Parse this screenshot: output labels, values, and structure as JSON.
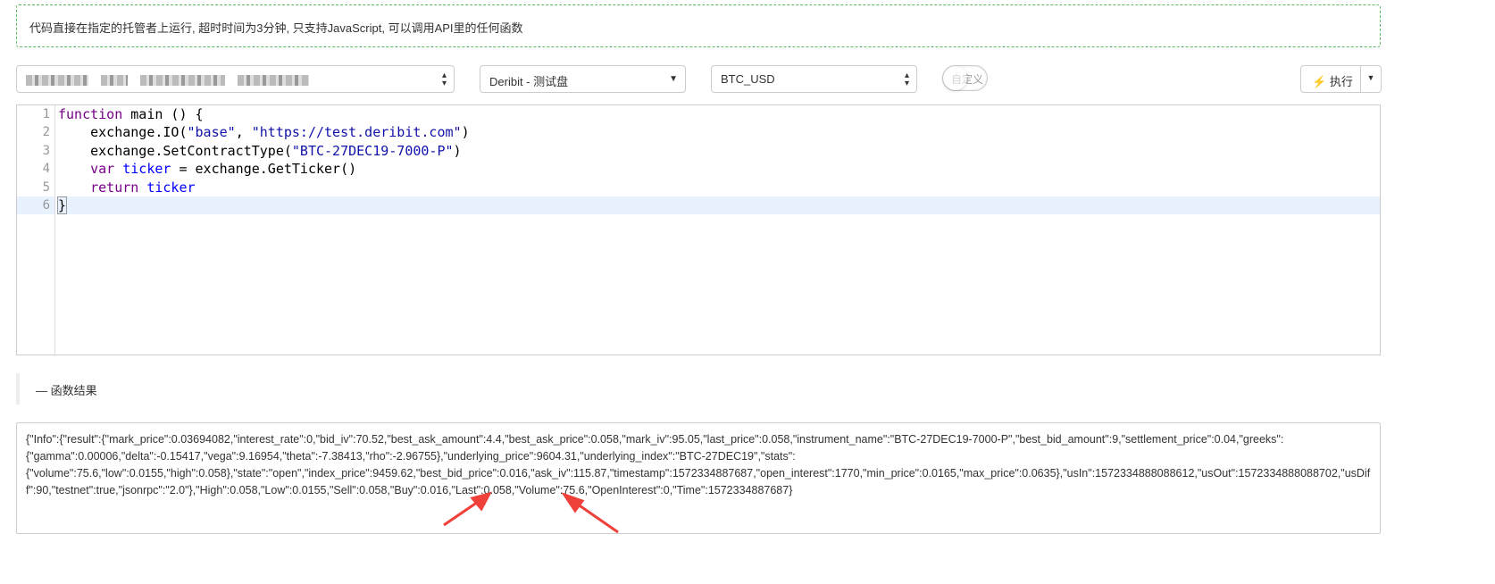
{
  "notice": "代码直接在指定的托管者上运行, 超时时间为3分钟, 只支持JavaScript, 可以调用API里的任何函数",
  "selects": {
    "exchange": "Deribit - 测试盘",
    "pair": "BTC_USD"
  },
  "toggle_label": "自定义",
  "run_label": "执行",
  "code_lines": [
    {
      "num": "1"
    },
    {
      "num": "2"
    },
    {
      "num": "3"
    },
    {
      "num": "4"
    },
    {
      "num": "5"
    },
    {
      "num": "6"
    }
  ],
  "code": {
    "l1a": "function",
    "l1b": " main () {",
    "l2a": "    exchange.IO(",
    "l2b": "\"base\"",
    "l2c": ", ",
    "l2d": "\"https://test.deribit.com\"",
    "l2e": ")",
    "l3a": "    exchange.SetContractType(",
    "l3b": "\"BTC-27DEC19-7000-P\"",
    "l3c": ")",
    "l4a": "    var",
    "l4b": " ticker",
    "l4c": " = exchange.GetTicker()",
    "l5a": "    return",
    "l5b": " ticker",
    "l6": "}"
  },
  "result_label": "— 函数结果",
  "result": "{\"Info\":{\"result\":{\"mark_price\":0.03694082,\"interest_rate\":0,\"bid_iv\":70.52,\"best_ask_amount\":4.4,\"best_ask_price\":0.058,\"mark_iv\":95.05,\"last_price\":0.058,\"instrument_name\":\"BTC-27DEC19-7000-P\",\"best_bid_amount\":9,\"settlement_price\":0.04,\"greeks\":{\"gamma\":0.00006,\"delta\":-0.15417,\"vega\":9.16954,\"theta\":-7.38413,\"rho\":-2.96755},\"underlying_price\":9604.31,\"underlying_index\":\"BTC-27DEC19\",\"stats\":{\"volume\":75.6,\"low\":0.0155,\"high\":0.058},\"state\":\"open\",\"index_price\":9459.62,\"best_bid_price\":0.016,\"ask_iv\":115.87,\"timestamp\":1572334887687,\"open_interest\":1770,\"min_price\":0.0165,\"max_price\":0.0635},\"usIn\":1572334888088612,\"usOut\":1572334888088702,\"usDiff\":90,\"testnet\":true,\"jsonrpc\":\"2.0\"},\"High\":0.058,\"Low\":0.0155,\"Sell\":0.058,\"Buy\":0.016,\"Last\":0.058,\"Volume\":75.6,\"OpenInterest\":0,\"Time\":1572334887687}"
}
